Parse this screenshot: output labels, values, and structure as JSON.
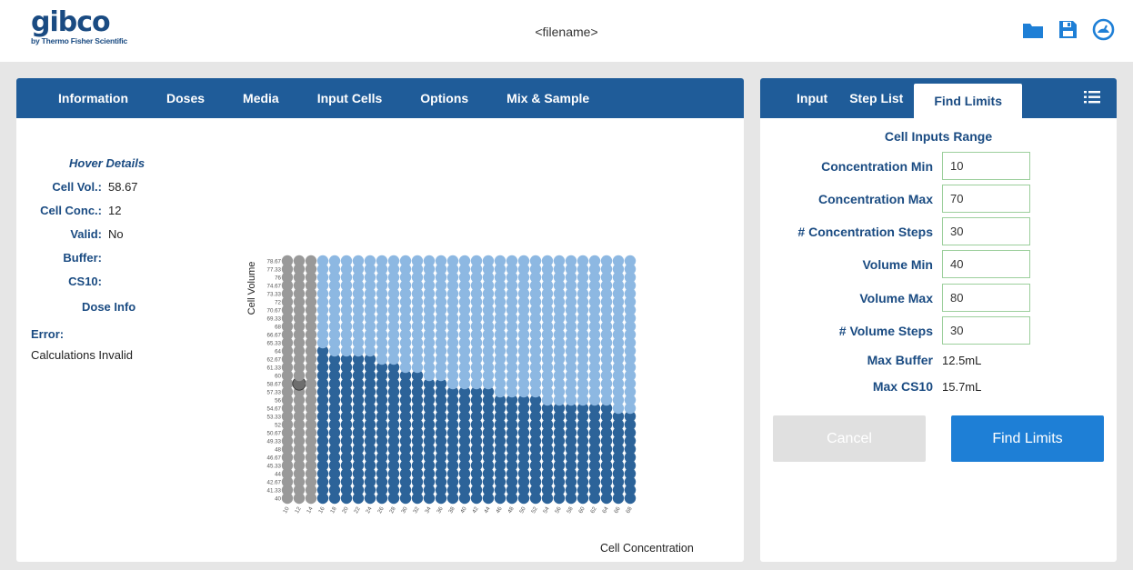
{
  "header": {
    "logo_main": "gibco",
    "logo_sub": "by Thermo Fisher Scientific",
    "filename": "<filename>",
    "icons": [
      "folder-icon",
      "save-icon",
      "dashboard-icon"
    ],
    "icon_color": "#1e7fd6"
  },
  "left_tabs": [
    "Information",
    "Doses",
    "Media",
    "Input Cells",
    "Options",
    "Mix & Sample"
  ],
  "right_tabs": [
    "Input",
    "Step List",
    "Find Limits"
  ],
  "right_active_tab": "Find Limits",
  "hover": {
    "title": "Hover Details",
    "cell_vol_label": "Cell Vol.:",
    "cell_vol": "58.67",
    "cell_conc_label": "Cell Conc.:",
    "cell_conc": "12",
    "valid_label": "Valid:",
    "valid": "No",
    "buffer_label": "Buffer:",
    "cs10_label": "CS10:",
    "dose_info": "Dose Info",
    "error_label": "Error:",
    "error_msg": "Calculations Invalid"
  },
  "form": {
    "title": "Cell Inputs Range",
    "conc_min_label": "Concentration Min",
    "conc_min": "10",
    "conc_max_label": "Concentration Max",
    "conc_max": "70",
    "conc_steps_label": "# Concentration Steps",
    "conc_steps": "30",
    "vol_min_label": "Volume Min",
    "vol_min": "40",
    "vol_max_label": "Volume Max",
    "vol_max": "80",
    "vol_steps_label": "# Volume Steps",
    "vol_steps": "30",
    "max_buffer_label": "Max Buffer",
    "max_buffer": "12.5mL",
    "max_cs10_label": "Max CS10",
    "max_cs10": "15.7mL",
    "cancel_label": "Cancel",
    "find_label": "Find Limits"
  },
  "chart_data": {
    "type": "scatter",
    "xlabel": "Cell Concentration",
    "ylabel": "Cell Volume",
    "x_ticks": [
      "10",
      "12",
      "14",
      "16",
      "18",
      "20",
      "22",
      "24",
      "26",
      "28",
      "30",
      "32",
      "34",
      "36",
      "38",
      "40",
      "42",
      "44",
      "46",
      "48",
      "50",
      "52",
      "54",
      "56",
      "58",
      "60",
      "62",
      "64",
      "66",
      "68"
    ],
    "y_ticks": [
      "40",
      "41.33",
      "42.67",
      "44",
      "45.33",
      "46.67",
      "48",
      "49.33",
      "50.67",
      "52",
      "53.33",
      "54.67",
      "56",
      "57.33",
      "58.67",
      "60",
      "61.33",
      "62.67",
      "64",
      "65.33",
      "66.67",
      "68",
      "69.33",
      "70.67",
      "72",
      "73.33",
      "74.67",
      "76",
      "77.33",
      "78.67"
    ],
    "invalid_columns": [
      "10",
      "12",
      "14"
    ],
    "valid_max_volume_per_column": [
      null,
      null,
      null,
      64,
      62.67,
      62.67,
      62.67,
      62.67,
      61.33,
      61.33,
      60,
      60,
      58.67,
      58.67,
      57.33,
      57.33,
      57.33,
      57.33,
      56,
      56,
      56,
      56,
      54.67,
      54.67,
      54.67,
      54.67,
      54.67,
      54.67,
      53.33,
      53.33
    ],
    "hovered_point": {
      "x": 12,
      "y": 58.67
    },
    "colors": {
      "invalid": "#999999",
      "out_of_range": "#8db8e2",
      "valid": "#2c6399",
      "hover": "#6e6e6e"
    }
  }
}
